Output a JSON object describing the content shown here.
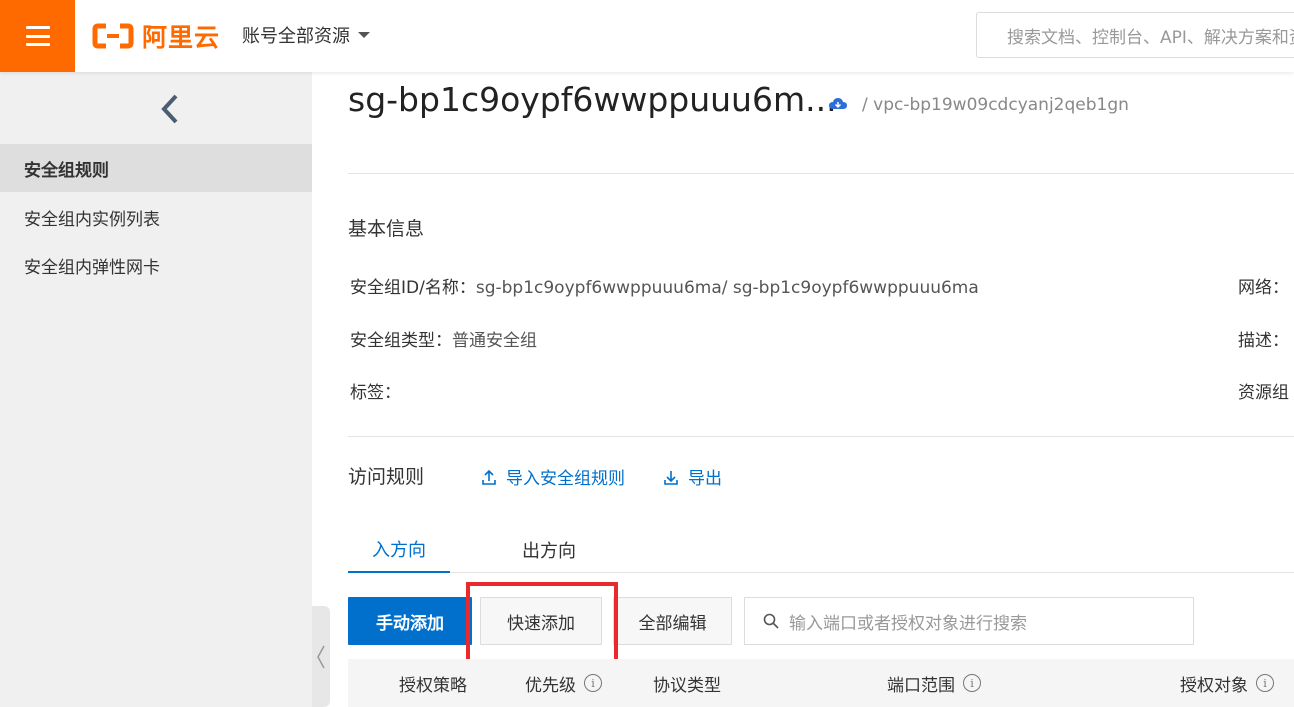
{
  "topbar": {
    "logo_text": "阿里云",
    "account_selector": "账号全部资源",
    "search_placeholder": "搜索文档、控制台、API、解决方案和资源"
  },
  "sidebar": {
    "items": [
      {
        "label": "安全组规则",
        "active": true
      },
      {
        "label": "安全组内实例列表",
        "active": false
      },
      {
        "label": "安全组内弹性网卡",
        "active": false
      }
    ]
  },
  "header": {
    "title": "sg-bp1c9oypf6wwppuuu6m...",
    "vpc": "/ vpc-bp19w09cdcyanj2qeb1gn"
  },
  "basic_info": {
    "title": "基本信息",
    "rows": [
      {
        "key": "安全组ID/名称：",
        "value": "sg-bp1c9oypf6wwppuuu6ma/ sg-bp1c9oypf6wwppuuu6ma"
      },
      {
        "key": "安全组类型：",
        "value": "普通安全组"
      },
      {
        "key": "标签：",
        "value": ""
      }
    ],
    "right_rows": [
      {
        "key": "网络："
      },
      {
        "key": "描述："
      },
      {
        "key": "资源组"
      }
    ]
  },
  "rules": {
    "title": "访问规则",
    "import_link": "导入安全组规则",
    "export_link": "导出",
    "tabs": [
      {
        "label": "入方向",
        "active": true
      },
      {
        "label": "出方向",
        "active": false
      }
    ],
    "buttons": {
      "manual_add": "手动添加",
      "quick_add": "快速添加",
      "edit_all": "全部编辑"
    },
    "search_placeholder": "输入端口或者授权对象进行搜索",
    "columns": [
      "授权策略",
      "优先级",
      "协议类型",
      "端口范围",
      "授权对象"
    ]
  },
  "colors": {
    "brand": "#ff6a00",
    "primary": "#0070cc",
    "highlight": "#e8292e"
  }
}
